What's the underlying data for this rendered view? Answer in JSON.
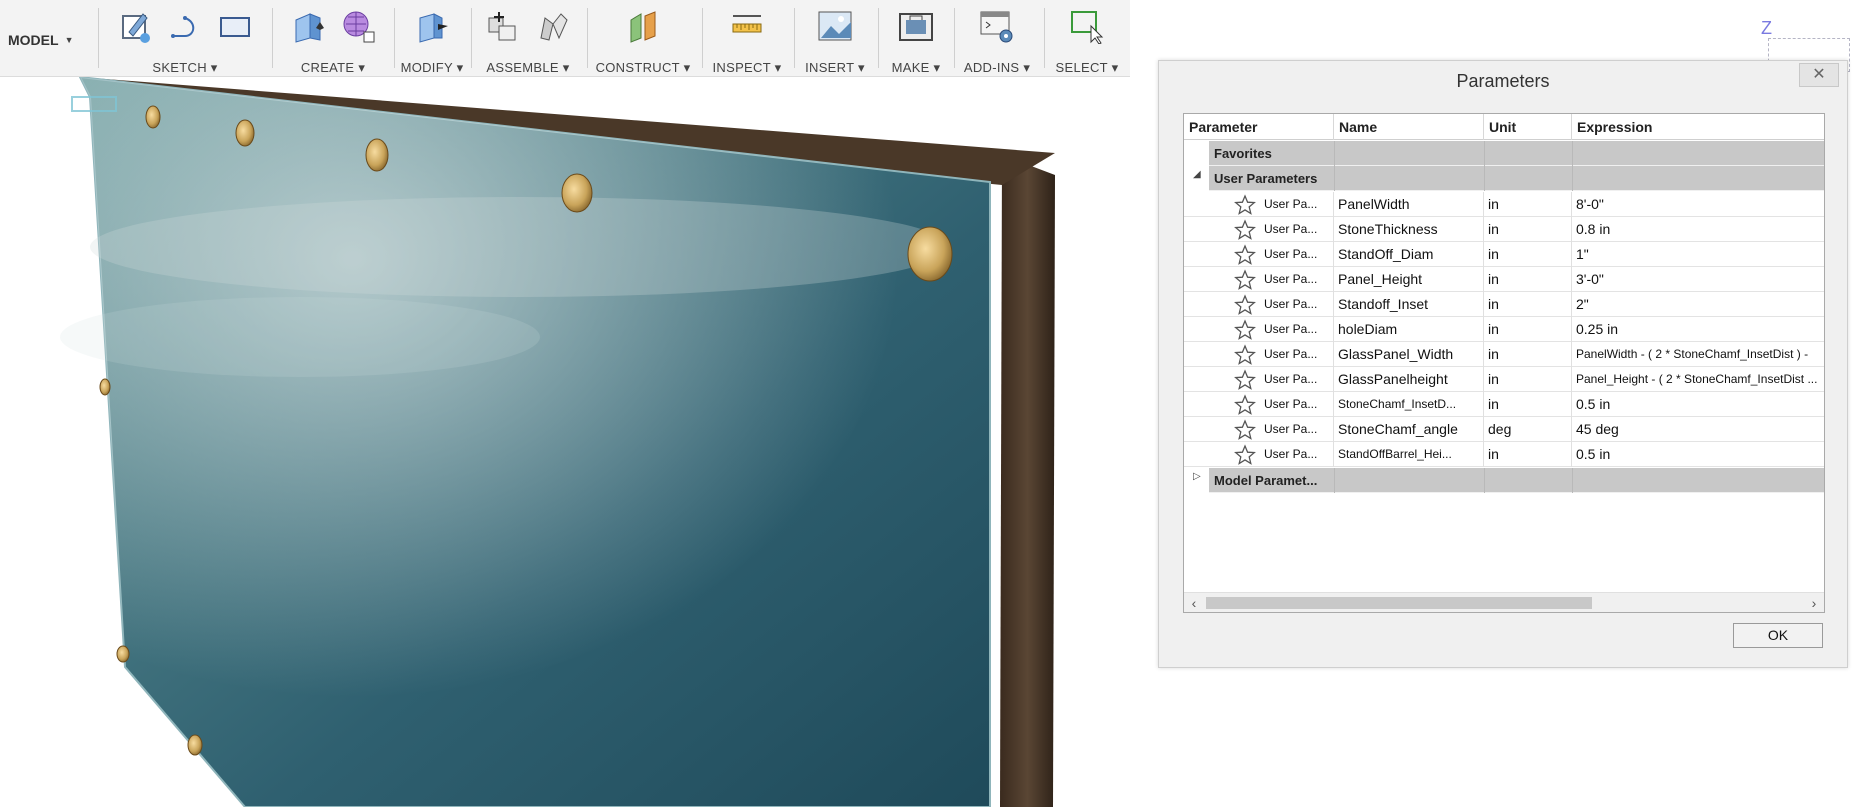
{
  "toolbar": {
    "model_label": "MODEL",
    "groups": [
      {
        "label": "SKETCH"
      },
      {
        "label": "CREATE"
      },
      {
        "label": "MODIFY"
      },
      {
        "label": "ASSEMBLE"
      },
      {
        "label": "CONSTRUCT"
      },
      {
        "label": "INSPECT"
      },
      {
        "label": "INSERT"
      },
      {
        "label": "MAKE"
      },
      {
        "label": "ADD-INS"
      },
      {
        "label": "SELECT"
      }
    ]
  },
  "viewcube": {
    "axis": "Z"
  },
  "dialog": {
    "title": "Parameters",
    "close_glyph": "✕",
    "ok_label": "OK",
    "columns": {
      "parameter": "Parameter",
      "name": "Name",
      "unit": "Unit",
      "expression": "Expression"
    },
    "groups": {
      "favorites": "Favorites",
      "user": "User Parameters",
      "model": "Model Paramet..."
    },
    "rows": [
      {
        "type": "User Pa...",
        "name": "PanelWidth",
        "unit": "in",
        "expression": "8'-0\""
      },
      {
        "type": "User Pa...",
        "name": "StoneThickness",
        "unit": "in",
        "expression": "0.8 in"
      },
      {
        "type": "User Pa...",
        "name": "StandOff_Diam",
        "unit": "in",
        "expression": "1\""
      },
      {
        "type": "User Pa...",
        "name": "Panel_Height",
        "unit": "in",
        "expression": "3'-0\""
      },
      {
        "type": "User Pa...",
        "name": "Standoff_Inset",
        "unit": "in",
        "expression": "2\""
      },
      {
        "type": "User Pa...",
        "name": "holeDiam",
        "unit": "in",
        "expression": "0.25 in"
      },
      {
        "type": "User Pa...",
        "name": "GlassPanel_Width",
        "unit": "in",
        "expression": "PanelWidth - ( 2 * StoneChamf_InsetDist ) -"
      },
      {
        "type": "User Pa...",
        "name": "GlassPanelheight",
        "unit": "in",
        "expression": "Panel_Height - ( 2 * StoneChamf_InsetDist ..."
      },
      {
        "type": "User Pa...",
        "name": "StoneChamf_InsetD...",
        "unit": "in",
        "expression": "0.5 in"
      },
      {
        "type": "User Pa...",
        "name": "StoneChamf_angle",
        "unit": "deg",
        "expression": "45 deg"
      },
      {
        "type": "User Pa...",
        "name": "StandOffBarrel_Hei...",
        "unit": "in",
        "expression": "0.5 in"
      }
    ]
  }
}
